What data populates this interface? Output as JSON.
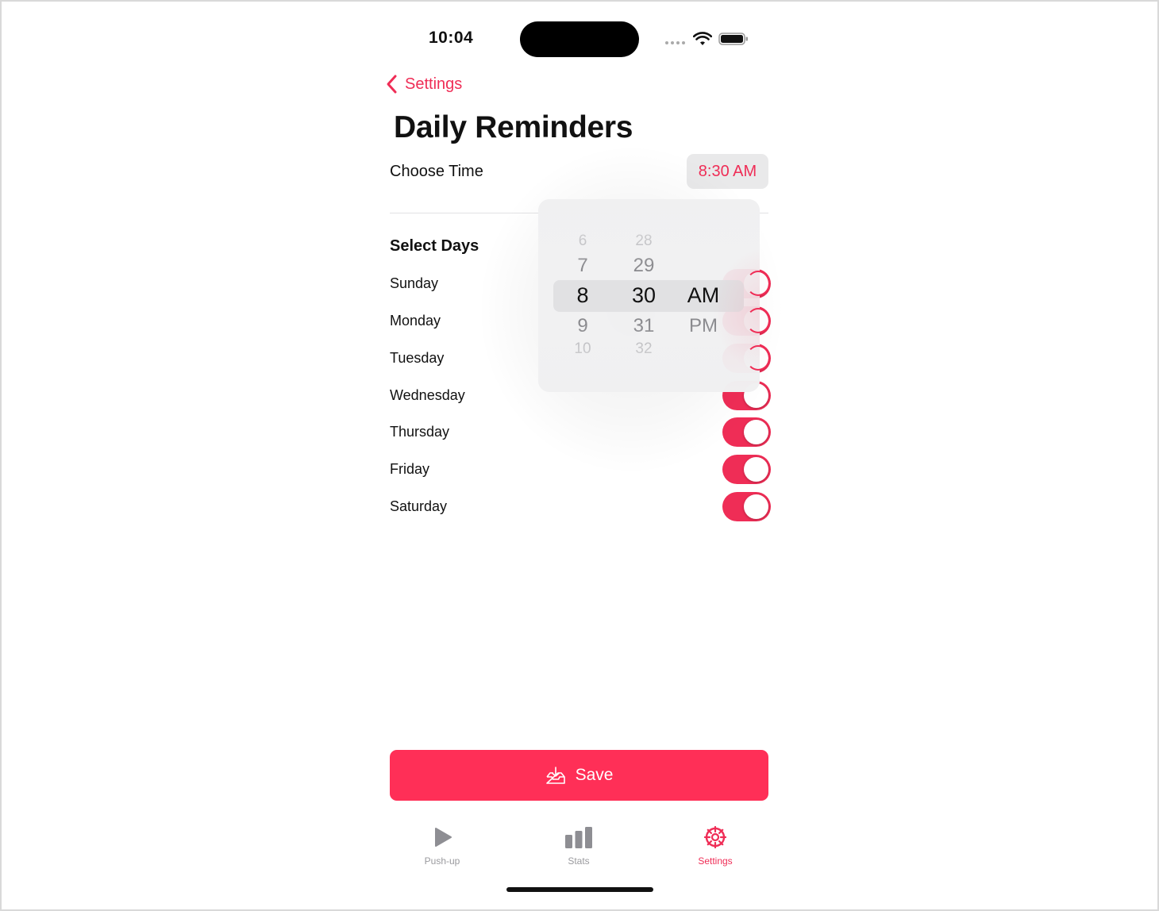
{
  "status_bar": {
    "time": "10:04"
  },
  "nav": {
    "back_label": "Settings"
  },
  "page": {
    "title": "Daily Reminders"
  },
  "time_setting": {
    "label": "Choose Time",
    "value": "8:30 AM"
  },
  "picker": {
    "hours": [
      "6",
      "7",
      "8",
      "9",
      "10"
    ],
    "minutes": [
      "28",
      "29",
      "30",
      "31",
      "32"
    ],
    "periods": [
      "AM",
      "PM"
    ],
    "selected": {
      "hour": "8",
      "minute": "30",
      "period": "AM"
    }
  },
  "days": {
    "heading": "Select Days",
    "items": [
      {
        "label": "Sunday",
        "enabled": true
      },
      {
        "label": "Monday",
        "enabled": true
      },
      {
        "label": "Tuesday",
        "enabled": true
      },
      {
        "label": "Wednesday",
        "enabled": true
      },
      {
        "label": "Thursday",
        "enabled": true
      },
      {
        "label": "Friday",
        "enabled": true
      },
      {
        "label": "Saturday",
        "enabled": true
      }
    ]
  },
  "save_button": {
    "label": "Save",
    "icon": "tray-download-icon"
  },
  "tabbar": {
    "items": [
      {
        "label": "Push-up",
        "icon": "play-icon",
        "active": false
      },
      {
        "label": "Stats",
        "icon": "bar-chart-icon",
        "active": false
      },
      {
        "label": "Settings",
        "icon": "gear-icon",
        "active": true
      }
    ]
  },
  "colors": {
    "accent": "#ef2d56",
    "save_button": "#ff2f57",
    "inactive_tab": "#9a9a9e"
  }
}
